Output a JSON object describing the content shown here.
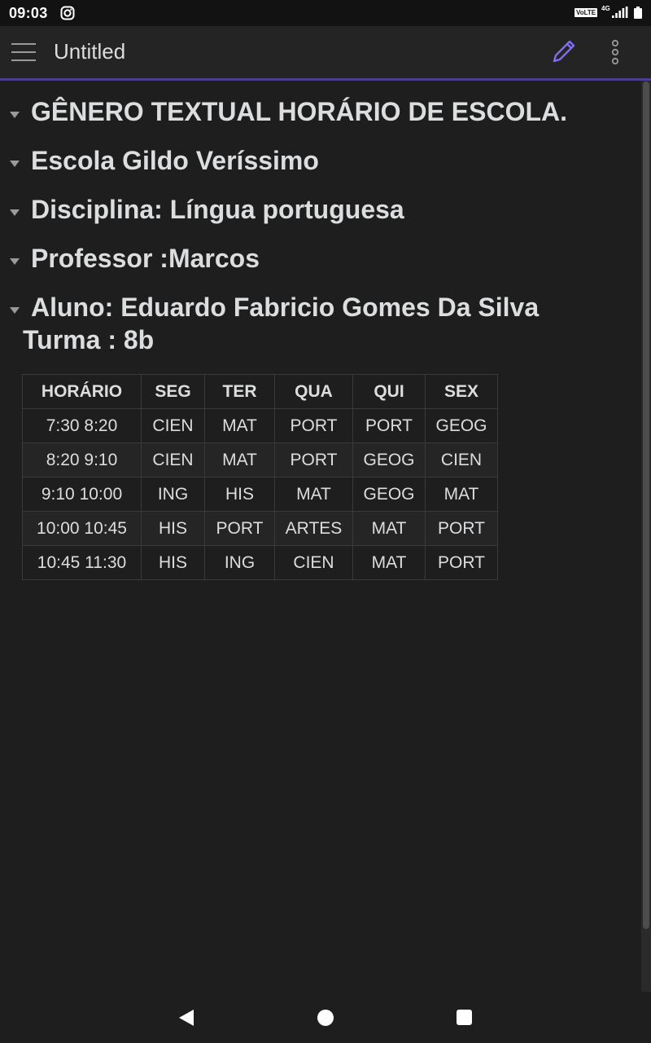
{
  "status_bar": {
    "time": "09:03",
    "volte": "VoLTE",
    "network": "4G"
  },
  "app_bar": {
    "title": "Untitled",
    "accent_color": "#7f6df2"
  },
  "document": {
    "headings": [
      "GÊNERO TEXTUAL HORÁRIO DE ESCOLA.",
      "Escola Gildo Veríssimo",
      "Disciplina: Língua portuguesa",
      "Professor :Marcos",
      "Aluno: Eduardo Fabricio Gomes Da Silva"
    ],
    "subline": "Turma : 8b",
    "table": {
      "headers": [
        "HORÁRIO",
        "SEG",
        "TER",
        "QUA",
        "QUI",
        "SEX"
      ],
      "rows": [
        [
          "7:30 8:20",
          "CIEN",
          "MAT",
          "PORT",
          "PORT",
          "GEOG"
        ],
        [
          "8:20 9:10",
          "CIEN",
          "MAT",
          "PORT",
          "GEOG",
          "CIEN"
        ],
        [
          "9:10 10:00",
          "ING",
          "HIS",
          "MAT",
          "GEOG",
          "MAT"
        ],
        [
          "10:00 10:45",
          "HIS",
          "PORT",
          "ARTES",
          "MAT",
          "PORT"
        ],
        [
          "10:45 11:30",
          "HIS",
          "ING",
          "CIEN",
          "MAT",
          "PORT"
        ]
      ]
    }
  },
  "icons": {
    "status": [
      "instagram-icon",
      "signal-icon",
      "battery-icon"
    ],
    "app_bar": [
      "hamburger-menu-icon",
      "pencil-edit-icon",
      "more-vert-icon"
    ],
    "nav": [
      "back-icon",
      "home-icon",
      "recents-icon"
    ]
  }
}
